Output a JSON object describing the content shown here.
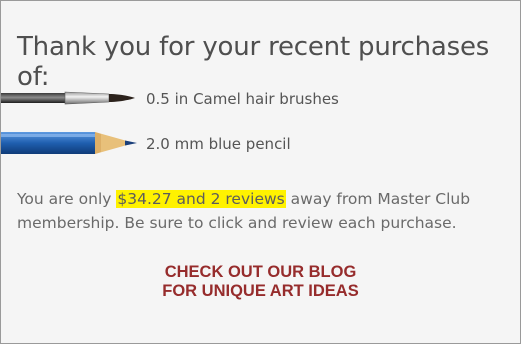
{
  "heading": "Thank you for your recent purchases of:",
  "items": [
    {
      "label": "0.5 in Camel hair brushes",
      "icon": "paintbrush-icon"
    },
    {
      "label": "2.0 mm blue pencil",
      "icon": "pencil-icon"
    }
  ],
  "message": {
    "before": "You are only ",
    "highlight": "$34.27 and 2 reviews",
    "after": " away from Master Club membership. Be sure to click and review each purchase."
  },
  "cta": {
    "line1": "CHECK OUT OUR BLOG",
    "line2": "FOR UNIQUE ART IDEAS"
  },
  "colors": {
    "highlight": "#fff200",
    "cta": "#962c2c",
    "pencil_blue": "#1f5fb0"
  }
}
